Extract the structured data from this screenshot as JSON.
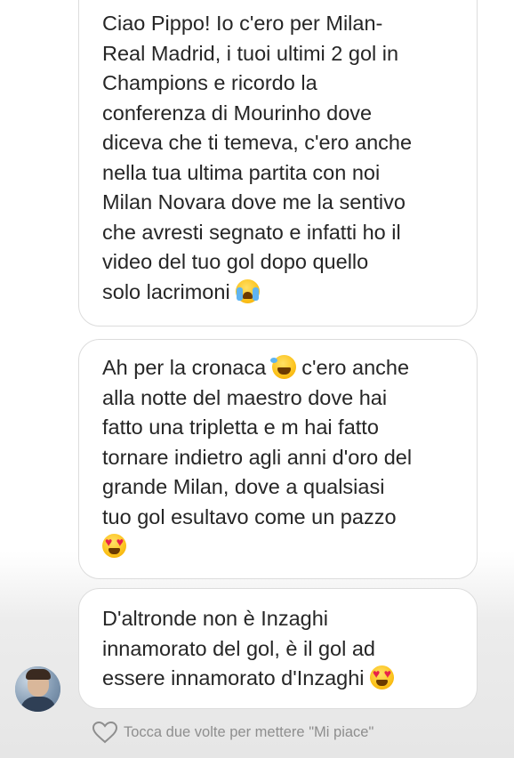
{
  "messages": [
    {
      "lines": [
        "Ciao Pippo! Io c'ero per Milan-",
        "Real Madrid, i tuoi ultimi 2 gol in",
        "Champions e ricordo la",
        "conferenza di Mourinho dove",
        "diceva che ti temeva, c'ero anche",
        "nella tua ultima partita con noi",
        "Milan Novara dove me la sentivo",
        "che avresti segnato e infatti ho il",
        "video del tuo gol dopo quello",
        "solo lacrimoni"
      ],
      "emoji": "loudly-crying-face"
    },
    {
      "line1_before": "Ah per la cronaca",
      "line1_emoji": "face-with-tears-of-joy",
      "line1_after": "c'ero anche",
      "lines": [
        "alla notte del maestro dove hai",
        "fatto una tripletta e m hai fatto",
        "tornare indietro agli anni d'oro del",
        "grande Milan, dove a qualsiasi",
        "tuo gol esultavo come un pazzo"
      ],
      "emoji": "smiling-face-with-heart-eyes"
    },
    {
      "lines": [
        "D'altronde non è Inzaghi",
        "innamorato del gol, è il gol ad",
        "essere innamorato d'Inzaghi"
      ],
      "emoji": "smiling-face-with-heart-eyes"
    }
  ],
  "like_hint": "Tocca due volte per mettere \"Mi piace\"",
  "colors": {
    "text": "#262626",
    "bubble_border": "#dcdcdc",
    "hint_text": "#8e8e8e"
  }
}
